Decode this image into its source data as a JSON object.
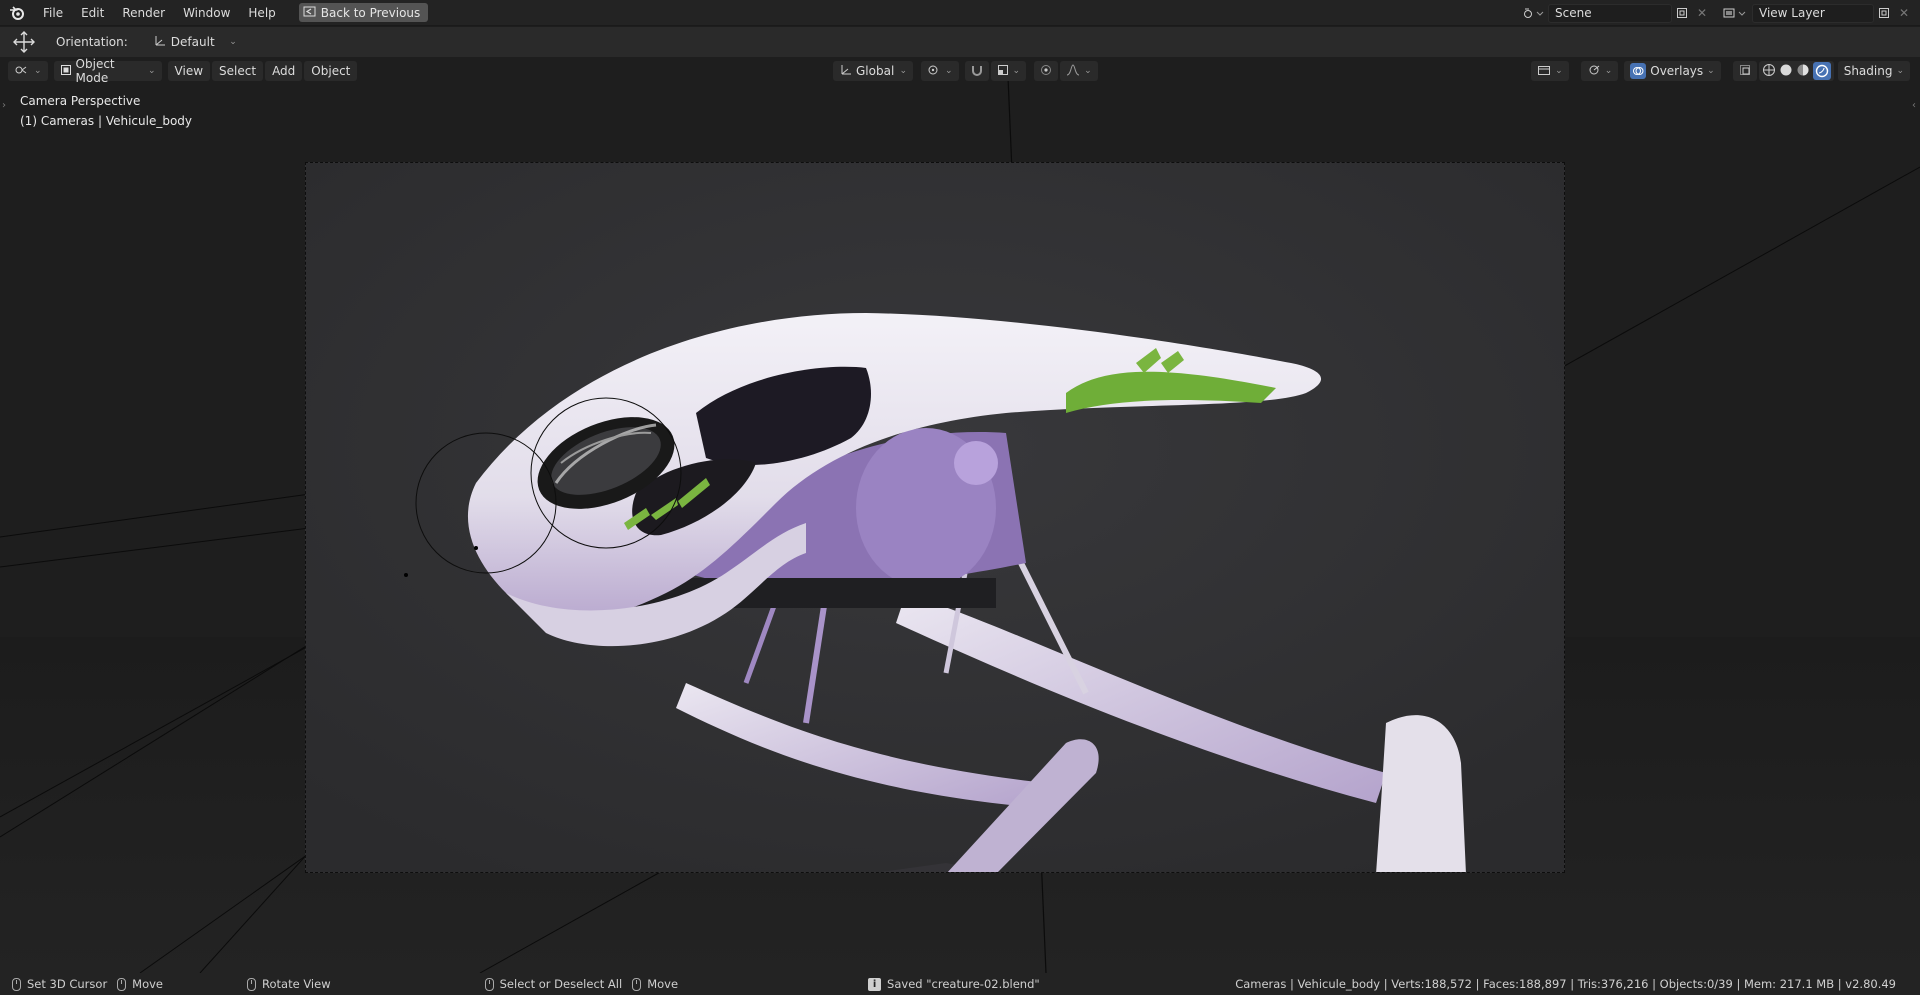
{
  "topbar": {
    "menus": [
      "File",
      "Edit",
      "Render",
      "Window",
      "Help"
    ],
    "back_label": "Back to Previous",
    "scene": "Scene",
    "view_layer": "View Layer"
  },
  "tool_settings": {
    "orientation_label": "Orientation:",
    "orientation_value": "Default"
  },
  "viewport_header": {
    "mode": "Object Mode",
    "menus": [
      "View",
      "Select",
      "Add",
      "Object"
    ],
    "transform": "Global",
    "overlays": "Overlays",
    "shading": "Shading"
  },
  "viewport": {
    "view_name": "Camera Perspective",
    "context": "(1) Cameras | Vehicule_body"
  },
  "statusbar": {
    "set_cursor": "Set 3D Cursor",
    "move1": "Move",
    "rotate": "Rotate View",
    "select": "Select or Deselect All",
    "move2": "Move",
    "saved": "Saved \"creature-02.blend\"",
    "stats": "Cameras | Vehicule_body | Verts:188,572 | Faces:188,897 | Tris:376,216 | Objects:0/39 | Mem: 217.1 MB | v2.80.49"
  },
  "colors": {
    "accent_blue": "#4772b3",
    "body_white": "#e9e6ee",
    "body_lilac": "#b9a4d6",
    "accent_green": "#7ab540"
  }
}
